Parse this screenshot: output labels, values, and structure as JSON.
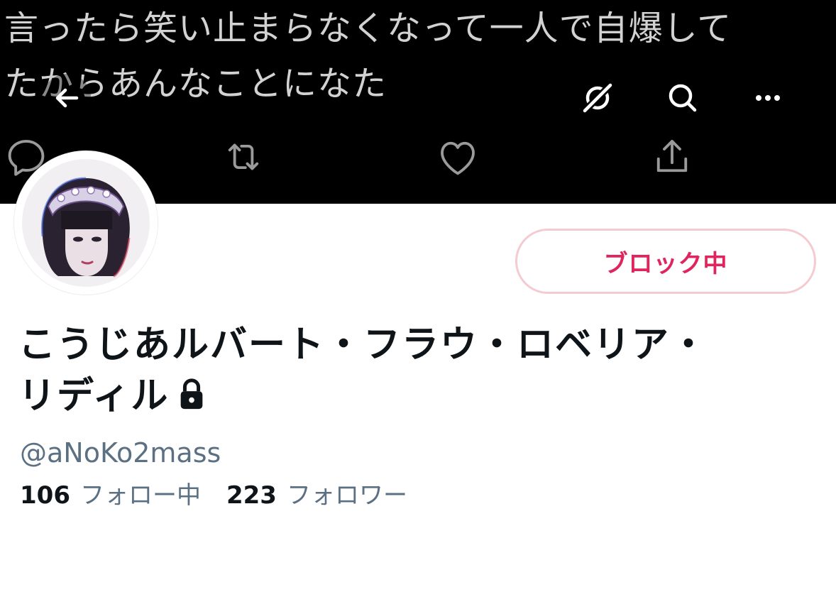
{
  "banner": {
    "text_line1": "言ったら笑い止まらなくなって一人で自爆して",
    "text_line2": "たからあんなことになた",
    "actions": [
      "reply-icon",
      "retweet-icon",
      "like-icon",
      "share-icon"
    ]
  },
  "nav": {
    "back_icon": "back-arrow-icon",
    "connect_icon": "disconnect-icon",
    "search_icon": "search-icon",
    "more_icon": "more-icon"
  },
  "profile": {
    "block_label": "ブロック中",
    "name_line1": "こうじあルバート・フラウ・ロベリア・",
    "name_line2": "リディル",
    "handle": "@aNoKo2mass",
    "following_count": "106",
    "following_label": "フォロー中",
    "followers_count": "223",
    "followers_label": "フォロワー"
  },
  "colors": {
    "block_text": "#e0245e",
    "block_border": "#f3cbd0",
    "secondary_text": "#5b7083",
    "primary_text": "#0f1419"
  }
}
